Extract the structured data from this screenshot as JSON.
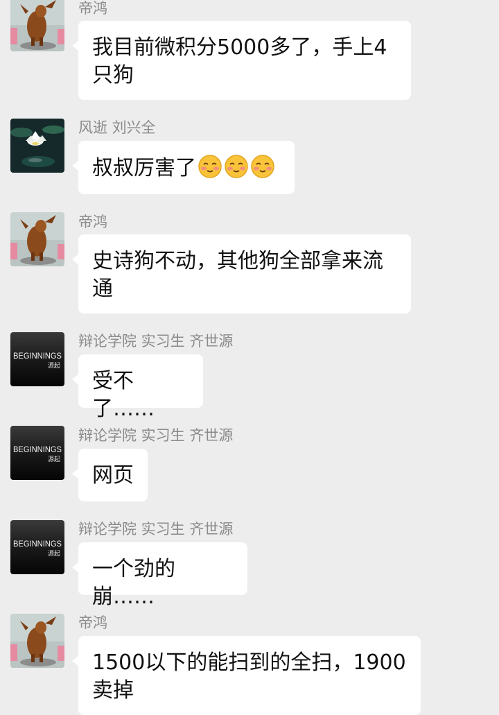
{
  "messages": [
    {
      "sender": "帝鸿",
      "avatar_icon": "deer-figure-avatar",
      "text": "我目前微积分5000多了，手上4只狗"
    },
    {
      "sender": "风逝 刘兴全",
      "avatar_icon": "lotus-avatar",
      "text": "叔叔厉害了",
      "emojis": [
        "shy-smile-emoji",
        "shy-smile-emoji",
        "shy-smile-emoji"
      ]
    },
    {
      "sender": "帝鸿",
      "avatar_icon": "deer-figure-avatar",
      "text": "史诗狗不动，其他狗全部拿来流通"
    },
    {
      "sender": "辩论学院 实习生 齐世源",
      "avatar_icon": "beginnings-avatar",
      "avatar_text": "BEGINNINGS",
      "avatar_subtext": "源起",
      "text": "受不了……"
    },
    {
      "sender": "辩论学院 实习生 齐世源",
      "avatar_icon": "beginnings-avatar",
      "avatar_text": "BEGINNINGS",
      "avatar_subtext": "源起",
      "text": "网页"
    },
    {
      "sender": "辩论学院 实习生 齐世源",
      "avatar_icon": "beginnings-avatar",
      "avatar_text": "BEGINNINGS",
      "avatar_subtext": "源起",
      "text": "一个劲的崩……"
    },
    {
      "sender": "帝鸿",
      "avatar_icon": "deer-figure-avatar",
      "text": "1500以下的能扫到的全扫，1900卖掉"
    }
  ],
  "colors": {
    "background": "#ededed",
    "bubble": "#ffffff",
    "sender_name": "#8a8a8a",
    "text": "#111111"
  }
}
